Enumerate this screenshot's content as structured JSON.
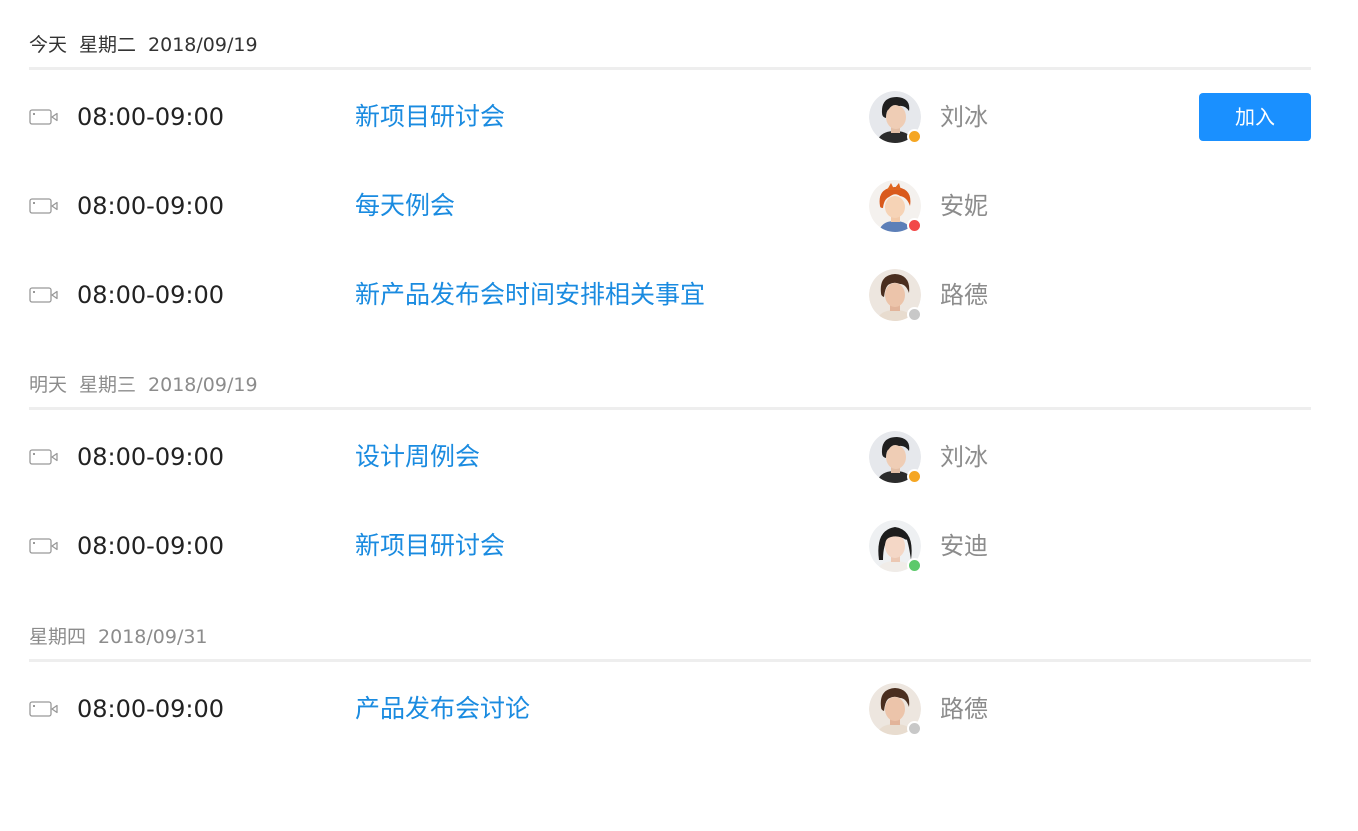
{
  "sections": [
    {
      "day": "今天",
      "weekday": "星期二",
      "date": "2018/09/19",
      "meetings": [
        {
          "time": "08:00-09:00",
          "title": "新项目研讨会",
          "person": "刘冰",
          "status": "away",
          "join_label": "加入"
        },
        {
          "time": "08:00-09:00",
          "title": "每天例会",
          "person": "安妮",
          "status": "busy"
        },
        {
          "time": "08:00-09:00",
          "title": "新产品发布会时间安排相关事宜",
          "person": "路德",
          "status": "offline"
        }
      ]
    },
    {
      "day": "明天",
      "weekday": "星期三",
      "date": "2018/09/19",
      "meetings": [
        {
          "time": "08:00-09:00",
          "title": "设计周例会",
          "person": "刘冰",
          "status": "away"
        },
        {
          "time": "08:00-09:00",
          "title": "新项目研讨会",
          "person": "安迪",
          "status": "online"
        }
      ]
    },
    {
      "day": "",
      "weekday": "星期四",
      "date": "2018/09/31",
      "meetings": [
        {
          "time": "08:00-09:00",
          "title": "产品发布会讨论",
          "person": "路德",
          "status": "offline"
        }
      ]
    }
  ],
  "icons": {
    "meeting_type": "video-camera-icon"
  },
  "colors": {
    "accent": "#1a90ff",
    "title_link": "#1a8be0",
    "status_away": "#f5a623",
    "status_busy": "#f24848",
    "status_offline": "#c8c8c8",
    "status_online": "#5cc96b"
  }
}
